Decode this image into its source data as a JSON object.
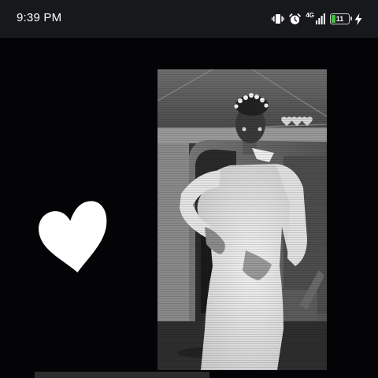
{
  "status_bar": {
    "time": "9:39 PM",
    "network_label": "4G",
    "battery_level": "11",
    "colors": {
      "battery_fill": "#3fbf3a",
      "background": "#17181c"
    },
    "icons": [
      "vibrate-icon",
      "alarm-icon",
      "signal-icon",
      "battery-icon",
      "charging-bolt-icon"
    ]
  },
  "content": {
    "background": "#040406",
    "heart_icon": "heart-icon",
    "photo_sticker": "small-hearts-icon"
  }
}
